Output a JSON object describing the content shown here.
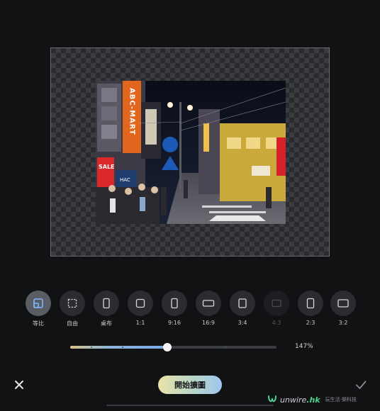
{
  "photo": {
    "shop_sign": "ABC-MART",
    "sale_sign": "SALE",
    "hac_sign": "HAC"
  },
  "ratios": [
    {
      "label": "等比",
      "icon": "lock-ratio-icon",
      "selected": true,
      "enabled": true
    },
    {
      "label": "自由",
      "icon": "freeform-crop-icon",
      "selected": false,
      "enabled": true
    },
    {
      "label": "桌布",
      "icon": "phone-wallpaper-icon",
      "selected": false,
      "enabled": true
    },
    {
      "label": "1:1",
      "icon": "square-icon",
      "selected": false,
      "enabled": true
    },
    {
      "label": "9:16",
      "icon": "portrait-9-16-icon",
      "selected": false,
      "enabled": true
    },
    {
      "label": "16:9",
      "icon": "landscape-16-9-icon",
      "selected": false,
      "enabled": true
    },
    {
      "label": "3:4",
      "icon": "portrait-3-4-icon",
      "selected": false,
      "enabled": true
    },
    {
      "label": "4:3",
      "icon": "landscape-4-3-icon",
      "selected": false,
      "enabled": false
    },
    {
      "label": "2:3",
      "icon": "portrait-2-3-icon",
      "selected": false,
      "enabled": true
    },
    {
      "label": "3:2",
      "icon": "landscape-3-2-icon",
      "selected": false,
      "enabled": true
    }
  ],
  "zoom": {
    "value_label": "147%",
    "fraction": 0.47
  },
  "actions": {
    "close_icon": "close-icon",
    "start_label": "開始擴圖",
    "confirm_icon": "check-icon"
  },
  "watermark": {
    "brand": "unwire",
    "suffix": ".hk",
    "tagline": "玩生活·樂科技"
  },
  "colors": {
    "background": "#111214",
    "accent_gradient_start": "#e9e2a8",
    "accent_gradient_end": "#9ec6ee",
    "brand_green": "#4fd08f"
  }
}
